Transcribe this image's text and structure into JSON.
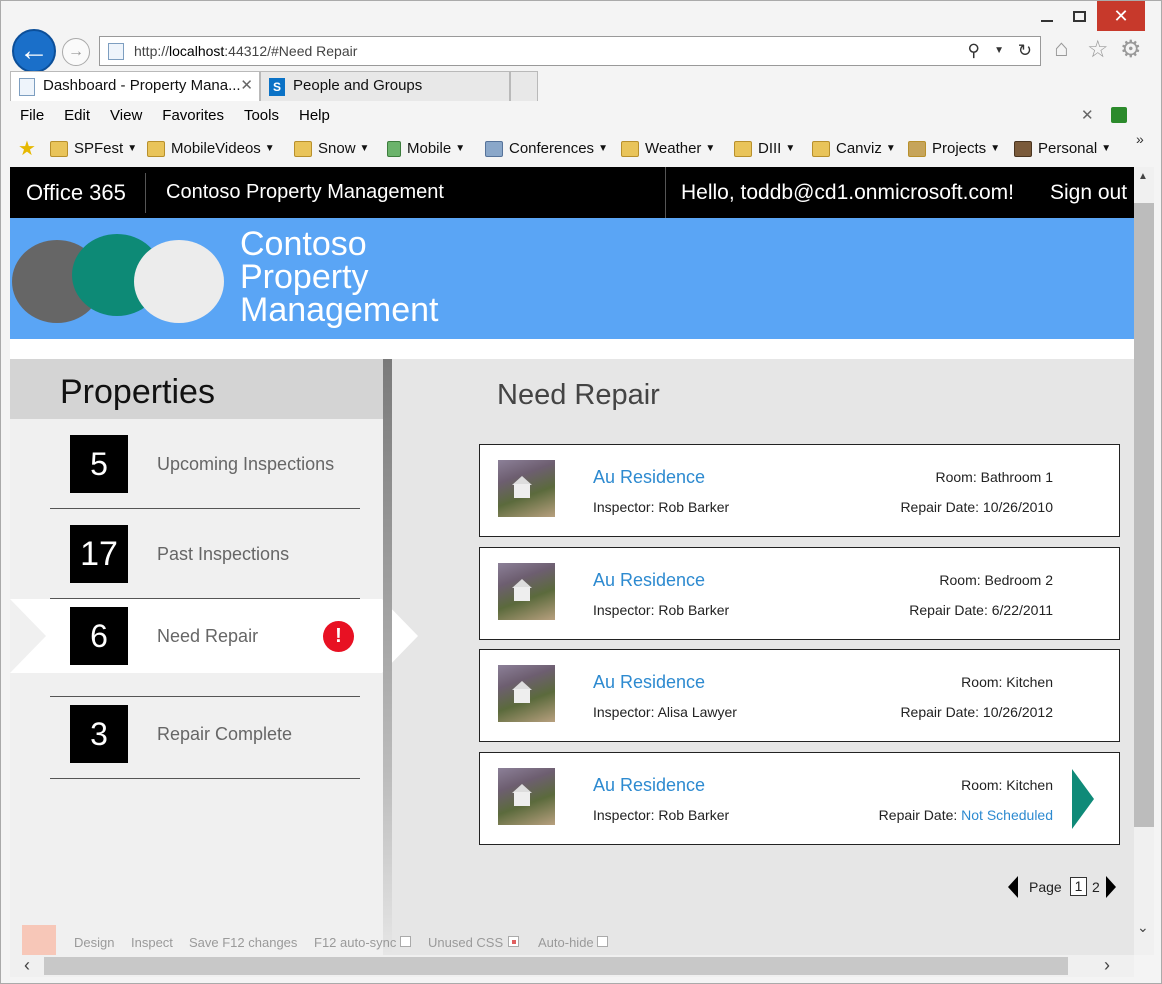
{
  "browser": {
    "address": {
      "prefix": "http://",
      "host": "localhost",
      "rest": ":44312/#Need Repair"
    },
    "tabs": [
      {
        "label": "Dashboard - Property Mana..."
      },
      {
        "label": "People and Groups"
      }
    ],
    "menu": [
      "File",
      "Edit",
      "View",
      "Favorites",
      "Tools",
      "Help"
    ],
    "favorites": [
      "SPFest",
      "MobileVideos",
      "Snow",
      "Mobile",
      "Conferences",
      "Weather",
      "DIII",
      "Canviz",
      "Projects",
      "Personal"
    ]
  },
  "suite": {
    "brand": "Office 365",
    "app": "Contoso Property Management",
    "greeting": "Hello, toddb@cd1.onmicrosoft.com!",
    "signout": "Sign out"
  },
  "banner": {
    "line1": "Contoso",
    "line2": "Property",
    "line3": "Management"
  },
  "sidebar": {
    "title": "Properties",
    "items": [
      {
        "count": "5",
        "label": "Upcoming Inspections"
      },
      {
        "count": "17",
        "label": "Past Inspections"
      },
      {
        "count": "6",
        "label": "Need Repair",
        "alert": "!"
      },
      {
        "count": "3",
        "label": "Repair Complete"
      }
    ]
  },
  "main": {
    "heading": "Need Repair",
    "cards": [
      {
        "title": "Au Residence",
        "inspector": "Inspector: Rob Barker",
        "room": "Room: Bathroom 1",
        "date_label": "Repair Date: ",
        "date": "10/26/2010"
      },
      {
        "title": "Au Residence",
        "inspector": "Inspector: Rob Barker",
        "room": "Room: Bedroom 2",
        "date_label": "Repair Date: ",
        "date": "6/22/2011"
      },
      {
        "title": "Au Residence",
        "inspector": "Inspector: Alisa Lawyer",
        "room": "Room: Kitchen",
        "date_label": "Repair Date: ",
        "date": "10/26/2012"
      },
      {
        "title": "Au Residence",
        "inspector": "Inspector: Rob Barker",
        "room": "Room: Kitchen",
        "date_label": "Repair Date: ",
        "date": "Not Scheduled"
      }
    ],
    "pager": {
      "label": "Page",
      "current": "1",
      "next": "2"
    }
  },
  "f12bar": [
    "Design",
    "Inspect",
    "Save F12 changes",
    "F12 auto-sync",
    "Unused CSS",
    "Auto-hide"
  ],
  "colors": {
    "suite": "#000000",
    "banner": "#5aa5f5",
    "accent": "#2d8ad0",
    "arrow": "#0f8a78",
    "alert": "#e81123"
  }
}
